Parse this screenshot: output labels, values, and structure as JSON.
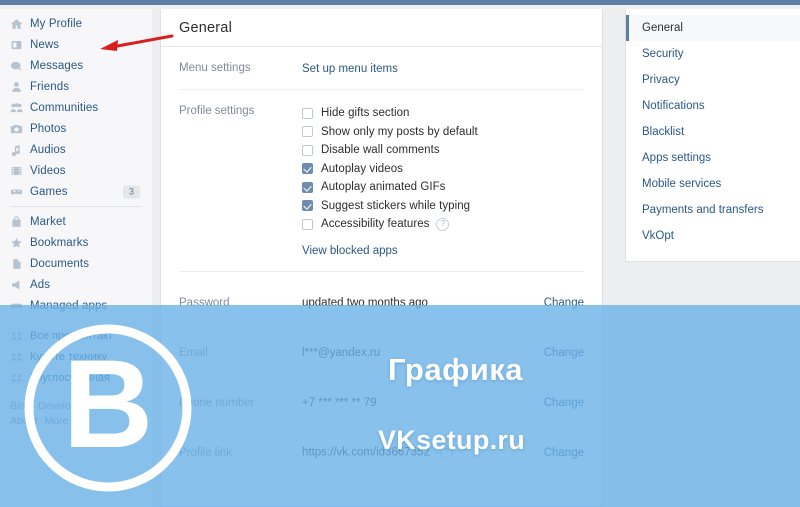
{
  "sidebar": {
    "items": [
      {
        "label": "My Profile",
        "icon": "home-icon",
        "badge": null
      },
      {
        "label": "News",
        "icon": "news-icon",
        "badge": null
      },
      {
        "label": "Messages",
        "icon": "messages-icon",
        "badge": null
      },
      {
        "label": "Friends",
        "icon": "friends-icon",
        "badge": null
      },
      {
        "label": "Communities",
        "icon": "communities-icon",
        "badge": null
      },
      {
        "label": "Photos",
        "icon": "photos-icon",
        "badge": null
      },
      {
        "label": "Audios",
        "icon": "audios-icon",
        "badge": null
      },
      {
        "label": "Videos",
        "icon": "videos-icon",
        "badge": null
      },
      {
        "label": "Games",
        "icon": "games-icon",
        "badge": "3"
      }
    ],
    "items2": [
      {
        "label": "Market",
        "icon": "market-icon"
      },
      {
        "label": "Bookmarks",
        "icon": "bookmarks-icon"
      },
      {
        "label": "Documents",
        "icon": "documents-icon"
      },
      {
        "label": "Ads",
        "icon": "ads-icon"
      },
      {
        "label": "Managed apps",
        "icon": "managed-apps-icon"
      }
    ],
    "groups": [
      {
        "label": "Все про Контакт"
      },
      {
        "label": "Купите технику"
      },
      {
        "label": "Круглосуточная"
      }
    ],
    "footer": [
      "Blog",
      "Developers",
      "About",
      "More"
    ]
  },
  "main": {
    "title": "General",
    "menu_settings": {
      "label": "Menu settings",
      "link": "Set up menu items"
    },
    "profile_settings": {
      "label": "Profile settings",
      "checkboxes": [
        {
          "label": "Hide gifts section",
          "checked": false,
          "help": false
        },
        {
          "label": "Show only my posts by default",
          "checked": false,
          "help": false
        },
        {
          "label": "Disable wall comments",
          "checked": false,
          "help": false
        },
        {
          "label": "Autoplay videos",
          "checked": true,
          "help": false
        },
        {
          "label": "Autoplay animated GIFs",
          "checked": true,
          "help": false
        },
        {
          "label": "Suggest stickers while typing",
          "checked": true,
          "help": false
        },
        {
          "label": "Accessibility features",
          "checked": false,
          "help": true
        }
      ],
      "blocked_link": "View blocked apps"
    },
    "account_rows": [
      {
        "label": "Password",
        "value": "updated two months ago",
        "action": "Change",
        "help": false
      },
      {
        "label": "Email",
        "value": "l***@yandex.ru",
        "action": "Change",
        "help": false
      },
      {
        "label": "Phone number",
        "value": "+7 *** *** ** 79",
        "action": "Change",
        "help": false
      },
      {
        "label": "Profile link",
        "value": "https://vk.com/id3667352",
        "action": "Change",
        "help": true
      }
    ]
  },
  "right_nav": {
    "items": [
      {
        "label": "General",
        "active": true
      },
      {
        "label": "Security",
        "active": false
      },
      {
        "label": "Privacy",
        "active": false
      },
      {
        "label": "Notifications",
        "active": false
      },
      {
        "label": "Blacklist",
        "active": false
      },
      {
        "label": "Apps settings",
        "active": false
      },
      {
        "label": "Mobile services",
        "active": false
      },
      {
        "label": "Payments and transfers",
        "active": false
      },
      {
        "label": "VkOpt",
        "active": false
      }
    ]
  },
  "overlay": {
    "logo_letter": "В",
    "watermark_title": "Графика",
    "watermark_site": "VKsetup.ru"
  },
  "annotation": {
    "arrow_color": "#d81f1f",
    "arrow_points_to": "News"
  },
  "colors": {
    "accent": "#5b7fa6",
    "link": "#2a5885",
    "overlay": "#6ab2e7",
    "checkbox_on": "#6d8cb0"
  }
}
